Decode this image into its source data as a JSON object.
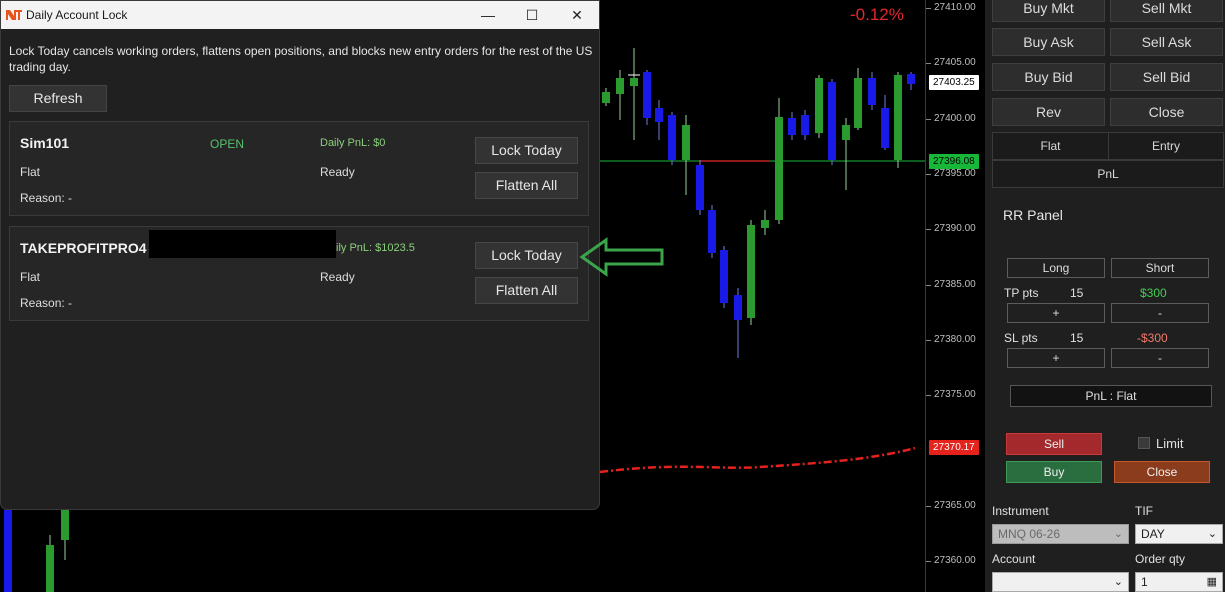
{
  "chart": {
    "change_pct": "-0.12%",
    "ticks": [
      {
        "label": "27410.00",
        "price": 27410
      },
      {
        "label": "27405.00",
        "price": 27405
      },
      {
        "label": "27400.00",
        "price": 27400
      },
      {
        "label": "27395.00",
        "price": 27395
      },
      {
        "label": "27390.00",
        "price": 27390
      },
      {
        "label": "27385.00",
        "price": 27385
      },
      {
        "label": "27380.00",
        "price": 27380
      },
      {
        "label": "27375.00",
        "price": 27375
      },
      {
        "label": "27365.00",
        "price": 27365
      },
      {
        "label": "27360.00",
        "price": 27360
      }
    ],
    "last_price_tag": "27403.25",
    "green_tag": "27396.08",
    "red_tag": "27370.17",
    "colors": {
      "up": "#2b9a2f",
      "down": "#1a1ae8",
      "green_line": "#17b83a",
      "red_line": "#e5221c"
    }
  },
  "dialog": {
    "title": "Daily Account Lock",
    "minimize_glyph": "—",
    "maximize_glyph": "☐",
    "close_glyph": "✕",
    "description": "Lock Today cancels working orders, flattens open positions, and blocks new entry orders for the rest of the US trading day.",
    "refresh_label": "Refresh",
    "accounts": [
      {
        "name": "Sim101",
        "state": "OPEN",
        "pnl": "Daily PnL: $0",
        "position": "Flat",
        "status": "Ready",
        "reason": "Reason: -",
        "lock_label": "Lock Today",
        "flatten_label": "Flatten All"
      },
      {
        "name": "TAKEPROFITPRO4",
        "state": "",
        "pnl": "ily PnL: $1023.5",
        "position": "Flat",
        "status": "Ready",
        "reason": "Reason: -",
        "lock_label": "Lock Today",
        "flatten_label": "Flatten All"
      }
    ]
  },
  "panel": {
    "buy_mkt": "Buy Mkt",
    "sell_mkt": "Sell Mkt",
    "buy_ask": "Buy Ask",
    "sell_ask": "Sell Ask",
    "buy_bid": "Buy Bid",
    "sell_bid": "Sell Bid",
    "rev": "Rev",
    "close": "Close",
    "tab_flat": "Flat",
    "tab_entry": "Entry",
    "tab_pnl": "PnL",
    "rr_title": "RR Panel",
    "long": "Long",
    "short": "Short",
    "tp_label": "TP pts",
    "tp_value": "15",
    "tp_money": "$300",
    "sl_label": "SL pts",
    "sl_value": "15",
    "sl_money": "-$300",
    "plus": "+",
    "minus": "-",
    "pnl_status": "PnL : Flat",
    "sell": "Sell",
    "buy": "Buy",
    "close_btn": "Close",
    "limit_label": "Limit",
    "instrument_label": "Instrument",
    "instrument_value": "MNQ 06-26",
    "tif_label": "TIF",
    "tif_value": "DAY",
    "account_label": "Account",
    "account_value": "",
    "qty_label": "Order qty",
    "qty_value": "1"
  }
}
